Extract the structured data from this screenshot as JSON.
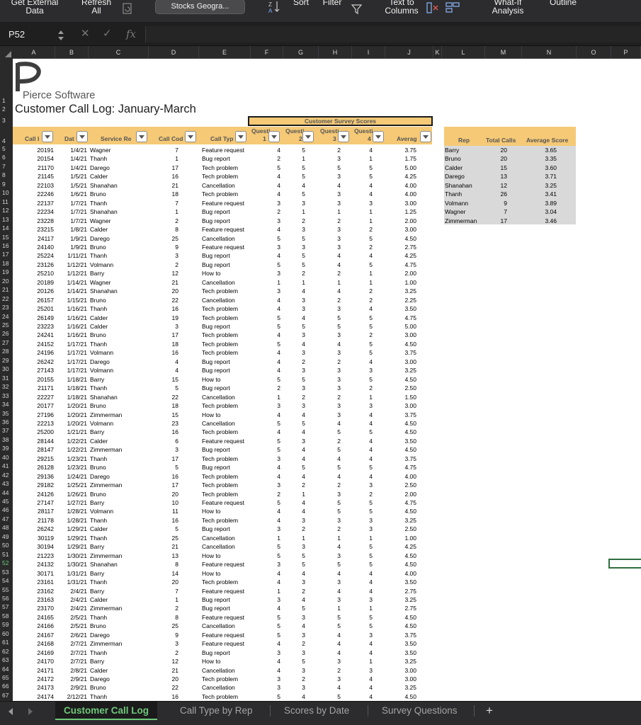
{
  "ribbon": {
    "get_external_data": [
      "Get External",
      "Data"
    ],
    "refresh_all": [
      "Refresh",
      "All"
    ],
    "stocks_geography": "Stocks Geogra...",
    "sort": "Sort",
    "filter": "Filter",
    "text_to_columns": [
      "Text to",
      "Columns"
    ],
    "what_if": [
      "What-If",
      "Analysis"
    ],
    "outline": "Outline"
  },
  "formula_bar": {
    "cell_ref": "P52",
    "fx": "fx",
    "value": ""
  },
  "colors": {
    "accent_header": "#f5c976",
    "side_table": "#d9d9d9",
    "active_tab": "#6fc97a"
  },
  "columns": [
    "A",
    "B",
    "C",
    "D",
    "E",
    "F",
    "G",
    "H",
    "I",
    "J",
    "K",
    "L",
    "M",
    "N",
    "O",
    "P"
  ],
  "rows": [
    "1",
    "2",
    "3",
    "4",
    "5",
    "6",
    "7",
    "8",
    "9",
    "10",
    "11",
    "12",
    "13",
    "14",
    "15",
    "16",
    "17",
    "18",
    "19",
    "20",
    "21",
    "22",
    "23",
    "24",
    "25",
    "26",
    "27",
    "28",
    "29",
    "30",
    "31",
    "32",
    "33",
    "34",
    "35",
    "36",
    "37",
    "38",
    "39",
    "40",
    "41",
    "42",
    "43",
    "44",
    "45",
    "46",
    "47",
    "48",
    "49",
    "50",
    "51",
    "52",
    "53",
    "54",
    "55",
    "56",
    "57",
    "58",
    "59",
    "60",
    "61",
    "62",
    "63",
    "64",
    "65",
    "66",
    "67"
  ],
  "selected_row": "52",
  "sheet": {
    "company": "Pierce Software",
    "title": "Customer Call Log: January-March",
    "survey_header": "Customer Survey Scores",
    "headers": {
      "call_id": "Call I",
      "date": "Dat",
      "service_rep": "Service Re",
      "call_code": "Call Cod",
      "call_type": "Call Typ",
      "q1_top": "Questi",
      "q1_num": "1",
      "q2_top": "Questi",
      "q2_num": "2",
      "q3_top": "Questi",
      "q3_num": "3",
      "q4_top": "Questi",
      "q4_num": "4",
      "average": "Averag"
    },
    "rows": [
      [
        "20191",
        "1/4/21",
        "Wagner",
        "7",
        "Feature request",
        "4",
        "5",
        "2",
        "4",
        "3.75"
      ],
      [
        "20154",
        "1/4/21",
        "Thanh",
        "1",
        "Bug report",
        "2",
        "1",
        "3",
        "1",
        "1.75"
      ],
      [
        "21170",
        "1/4/21",
        "Darego",
        "17",
        "Tech problem",
        "5",
        "5",
        "5",
        "5",
        "5.00"
      ],
      [
        "21145",
        "1/5/21",
        "Calder",
        "16",
        "Tech problem",
        "4",
        "5",
        "3",
        "5",
        "4.25"
      ],
      [
        "22103",
        "1/5/21",
        "Shanahan",
        "21",
        "Cancellation",
        "4",
        "4",
        "4",
        "4",
        "4.00"
      ],
      [
        "22246",
        "1/6/21",
        "Bruno",
        "18",
        "Tech problem",
        "4",
        "5",
        "3",
        "4",
        "4.00"
      ],
      [
        "22137",
        "1/7/21",
        "Thanh",
        "7",
        "Feature request",
        "3",
        "3",
        "3",
        "3",
        "3.00"
      ],
      [
        "22234",
        "1/7/21",
        "Shanahan",
        "1",
        "Bug report",
        "2",
        "1",
        "1",
        "1",
        "1.25"
      ],
      [
        "23228",
        "1/7/21",
        "Wagner",
        "2",
        "Bug report",
        "3",
        "2",
        "2",
        "1",
        "2.00"
      ],
      [
        "23215",
        "1/8/21",
        "Calder",
        "8",
        "Feature request",
        "4",
        "3",
        "3",
        "2",
        "3.00"
      ],
      [
        "24117",
        "1/9/21",
        "Darego",
        "25",
        "Cancellation",
        "5",
        "5",
        "3",
        "5",
        "4.50"
      ],
      [
        "24140",
        "1/9/21",
        "Bruno",
        "9",
        "Feature request",
        "3",
        "3",
        "3",
        "2",
        "2.75"
      ],
      [
        "25224",
        "1/11/21",
        "Thanh",
        "3",
        "Bug report",
        "4",
        "5",
        "4",
        "4",
        "4.25"
      ],
      [
        "23126",
        "1/12/21",
        "Volmann",
        "2",
        "Bug report",
        "5",
        "5",
        "4",
        "5",
        "4.75"
      ],
      [
        "25210",
        "1/12/21",
        "Barry",
        "12",
        "How to",
        "3",
        "2",
        "2",
        "1",
        "2.00"
      ],
      [
        "20189",
        "1/14/21",
        "Wagner",
        "21",
        "Cancellation",
        "1",
        "1",
        "1",
        "1",
        "1.00"
      ],
      [
        "20126",
        "1/14/21",
        "Shanahan",
        "20",
        "Tech problem",
        "3",
        "4",
        "4",
        "2",
        "3.25"
      ],
      [
        "26157",
        "1/15/21",
        "Bruno",
        "22",
        "Cancellation",
        "4",
        "3",
        "2",
        "2",
        "2.25"
      ],
      [
        "25201",
        "1/16/21",
        "Thanh",
        "16",
        "Tech problem",
        "4",
        "3",
        "3",
        "4",
        "3.50"
      ],
      [
        "26149",
        "1/16/21",
        "Calder",
        "19",
        "Tech problem",
        "5",
        "4",
        "5",
        "5",
        "4.75"
      ],
      [
        "23223",
        "1/16/21",
        "Calder",
        "3",
        "Bug report",
        "5",
        "5",
        "5",
        "5",
        "5.00"
      ],
      [
        "24241",
        "1/16/21",
        "Bruno",
        "17",
        "Tech problem",
        "4",
        "3",
        "3",
        "2",
        "3.00"
      ],
      [
        "24152",
        "1/17/21",
        "Thanh",
        "18",
        "Tech problem",
        "5",
        "4",
        "4",
        "5",
        "4.50"
      ],
      [
        "24196",
        "1/17/21",
        "Volmann",
        "16",
        "Tech problem",
        "4",
        "3",
        "3",
        "5",
        "3.75"
      ],
      [
        "26242",
        "1/17/21",
        "Darego",
        "4",
        "Bug report",
        "4",
        "2",
        "2",
        "4",
        "3.00"
      ],
      [
        "27143",
        "1/17/21",
        "Volmann",
        "4",
        "Bug report",
        "4",
        "3",
        "3",
        "3",
        "3.25"
      ],
      [
        "20155",
        "1/18/21",
        "Barry",
        "15",
        "How to",
        "5",
        "5",
        "3",
        "5",
        "4.50"
      ],
      [
        "21171",
        "1/18/21",
        "Thanh",
        "5",
        "Bug report",
        "2",
        "3",
        "3",
        "2",
        "2.50"
      ],
      [
        "22227",
        "1/18/21",
        "Shanahan",
        "22",
        "Cancellation",
        "1",
        "2",
        "2",
        "1",
        "1.50"
      ],
      [
        "20177",
        "1/20/21",
        "Bruno",
        "18",
        "Tech problem",
        "3",
        "3",
        "3",
        "3",
        "3.00"
      ],
      [
        "27196",
        "1/20/21",
        "Zimmerman",
        "15",
        "How to",
        "4",
        "4",
        "3",
        "4",
        "3.75"
      ],
      [
        "22213",
        "1/20/21",
        "Volmann",
        "23",
        "Cancellation",
        "5",
        "5",
        "4",
        "4",
        "4.50"
      ],
      [
        "25200",
        "1/21/21",
        "Barry",
        "16",
        "Tech problem",
        "4",
        "4",
        "5",
        "5",
        "4.50"
      ],
      [
        "28144",
        "1/22/21",
        "Calder",
        "6",
        "Feature request",
        "5",
        "3",
        "2",
        "4",
        "3.50"
      ],
      [
        "28147",
        "1/22/21",
        "Zimmerman",
        "3",
        "Bug report",
        "5",
        "4",
        "5",
        "4",
        "4.50"
      ],
      [
        "29215",
        "1/23/21",
        "Thanh",
        "17",
        "Tech problem",
        "3",
        "4",
        "4",
        "4",
        "3.75"
      ],
      [
        "26128",
        "1/23/21",
        "Bruno",
        "5",
        "Bug report",
        "4",
        "5",
        "5",
        "5",
        "4.75"
      ],
      [
        "29136",
        "1/24/21",
        "Darego",
        "16",
        "Tech problem",
        "4",
        "4",
        "4",
        "4",
        "4.00"
      ],
      [
        "29182",
        "1/25/21",
        "Zimmerman",
        "17",
        "Tech problem",
        "3",
        "2",
        "2",
        "3",
        "2.50"
      ],
      [
        "24126",
        "1/26/21",
        "Bruno",
        "20",
        "Tech problem",
        "2",
        "1",
        "3",
        "2",
        "2.00"
      ],
      [
        "27147",
        "1/27/21",
        "Barry",
        "10",
        "Feature request",
        "5",
        "4",
        "5",
        "5",
        "4.75"
      ],
      [
        "28117",
        "1/28/21",
        "Volmann",
        "11",
        "How to",
        "4",
        "4",
        "5",
        "5",
        "4.50"
      ],
      [
        "21178",
        "1/28/21",
        "Thanh",
        "16",
        "Tech problem",
        "4",
        "3",
        "3",
        "3",
        "3.25"
      ],
      [
        "26242",
        "1/29/21",
        "Calder",
        "5",
        "Bug report",
        "3",
        "2",
        "2",
        "3",
        "2.50"
      ],
      [
        "30119",
        "1/29/21",
        "Thanh",
        "25",
        "Cancellation",
        "1",
        "1",
        "1",
        "1",
        "1.00"
      ],
      [
        "30194",
        "1/29/21",
        "Barry",
        "21",
        "Cancellation",
        "5",
        "3",
        "4",
        "5",
        "4.25"
      ],
      [
        "21223",
        "1/30/21",
        "Zimmerman",
        "13",
        "How to",
        "5",
        "5",
        "3",
        "5",
        "4.50"
      ],
      [
        "24132",
        "1/30/21",
        "Shanahan",
        "8",
        "Feature request",
        "3",
        "5",
        "5",
        "5",
        "4.50"
      ],
      [
        "30171",
        "1/31/21",
        "Barry",
        "14",
        "How to",
        "4",
        "4",
        "4",
        "4",
        "4.00"
      ],
      [
        "23161",
        "1/31/21",
        "Thanh",
        "20",
        "Tech problem",
        "4",
        "3",
        "3",
        "4",
        "3.50"
      ],
      [
        "23162",
        "2/4/21",
        "Barry",
        "7",
        "Feature request",
        "1",
        "2",
        "4",
        "4",
        "2.75"
      ],
      [
        "23163",
        "2/4/21",
        "Calder",
        "1",
        "Bug report",
        "3",
        "4",
        "3",
        "3",
        "3.25"
      ],
      [
        "23170",
        "2/4/21",
        "Zimmerman",
        "2",
        "Bug report",
        "4",
        "5",
        "1",
        "1",
        "2.75"
      ],
      [
        "24165",
        "2/5/21",
        "Thanh",
        "8",
        "Feature request",
        "5",
        "3",
        "5",
        "5",
        "4.50"
      ],
      [
        "24166",
        "2/5/21",
        "Bruno",
        "25",
        "Cancellation",
        "5",
        "4",
        "5",
        "5",
        "4.50"
      ],
      [
        "24167",
        "2/6/21",
        "Darego",
        "9",
        "Feature request",
        "5",
        "3",
        "4",
        "3",
        "3.75"
      ],
      [
        "24168",
        "2/7/21",
        "Zimmerman",
        "3",
        "Feature request",
        "4",
        "2",
        "4",
        "4",
        "3.50"
      ],
      [
        "24169",
        "2/7/21",
        "Thanh",
        "2",
        "Bug report",
        "3",
        "3",
        "4",
        "4",
        "3.50"
      ],
      [
        "24170",
        "2/7/21",
        "Barry",
        "12",
        "How to",
        "4",
        "5",
        "3",
        "1",
        "3.25"
      ],
      [
        "24171",
        "2/8/21",
        "Calder",
        "21",
        "Cancellation",
        "4",
        "3",
        "2",
        "3",
        "3.00"
      ],
      [
        "24172",
        "2/9/21",
        "Darego",
        "20",
        "Tech problem",
        "3",
        "2",
        "3",
        "4",
        "3.00"
      ],
      [
        "24173",
        "2/9/21",
        "Bruno",
        "22",
        "Cancellation",
        "3",
        "3",
        "4",
        "4",
        "3.25"
      ],
      [
        "24174",
        "2/12/21",
        "Thanh",
        "16",
        "Tech problem",
        "5",
        "4",
        "5",
        "4",
        "4.50"
      ]
    ],
    "side": {
      "headers": [
        "Rep",
        "Total Calls",
        "Average Score"
      ],
      "rows": [
        [
          "Barry",
          "20",
          "3.65"
        ],
        [
          "Bruno",
          "20",
          "3.35"
        ],
        [
          "Calder",
          "15",
          "3.60"
        ],
        [
          "Darego",
          "13",
          "3.71"
        ],
        [
          "Shanahan",
          "12",
          "3.25"
        ],
        [
          "Thanh",
          "26",
          "3.41"
        ],
        [
          "Volmann",
          "9",
          "3.89"
        ],
        [
          "Wagner",
          "7",
          "3.04"
        ],
        [
          "Zimmerman",
          "17",
          "3.46"
        ]
      ]
    }
  },
  "tabs": {
    "active": "Customer Call Log",
    "others": [
      "Call Type by Rep",
      "Scores by Date",
      "Survey Questions"
    ],
    "add": "+"
  }
}
